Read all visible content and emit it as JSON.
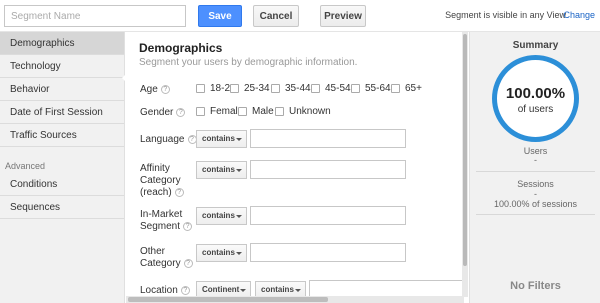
{
  "topbar": {
    "segment_name_placeholder": "Segment Name",
    "save_label": "Save",
    "cancel_label": "Cancel",
    "preview_label": "Preview",
    "visibility_text": "Segment is visible in any View",
    "change_label": "Change"
  },
  "sidebar": {
    "items": [
      {
        "label": "Demographics",
        "active": true
      },
      {
        "label": "Technology"
      },
      {
        "label": "Behavior"
      },
      {
        "label": "Date of First Session"
      },
      {
        "label": "Traffic Sources"
      }
    ],
    "advanced_heading": "Advanced",
    "advanced_items": [
      {
        "label": "Conditions"
      },
      {
        "label": "Sequences"
      }
    ]
  },
  "main": {
    "title": "Demographics",
    "subtitle": "Segment your users by demographic information.",
    "help_glyph": "?",
    "age": {
      "label": "Age",
      "options": [
        "18-24",
        "25-34",
        "35-44",
        "45-54",
        "55-64",
        "65+"
      ]
    },
    "gender": {
      "label": "Gender",
      "options": [
        "Female",
        "Male",
        "Unknown"
      ]
    },
    "language": {
      "label": "Language",
      "operator": "contains",
      "value": ""
    },
    "affinity": {
      "label_lines": [
        "Affinity",
        "Category",
        "(reach)"
      ],
      "operator": "contains",
      "value": ""
    },
    "in_market": {
      "label_lines": [
        "In-Market",
        "Segment"
      ],
      "operator": "contains",
      "value": ""
    },
    "other": {
      "label_lines": [
        "Other",
        "Category"
      ],
      "operator": "contains",
      "value": ""
    },
    "location": {
      "label": "Location",
      "scope": "Continent",
      "operator": "contains",
      "value": ""
    }
  },
  "summary": {
    "title": "Summary",
    "percent": "100.00%",
    "percent_caption": "of users",
    "users_label": "Users",
    "users_value": "-",
    "sessions_label": "Sessions",
    "sessions_value": "-",
    "sessions_caption": "100.00% of sessions",
    "no_filters": "No Filters"
  },
  "colors": {
    "save_button": "#4d90fe",
    "ring": "#2c8fd8",
    "link": "#1a64c6"
  }
}
